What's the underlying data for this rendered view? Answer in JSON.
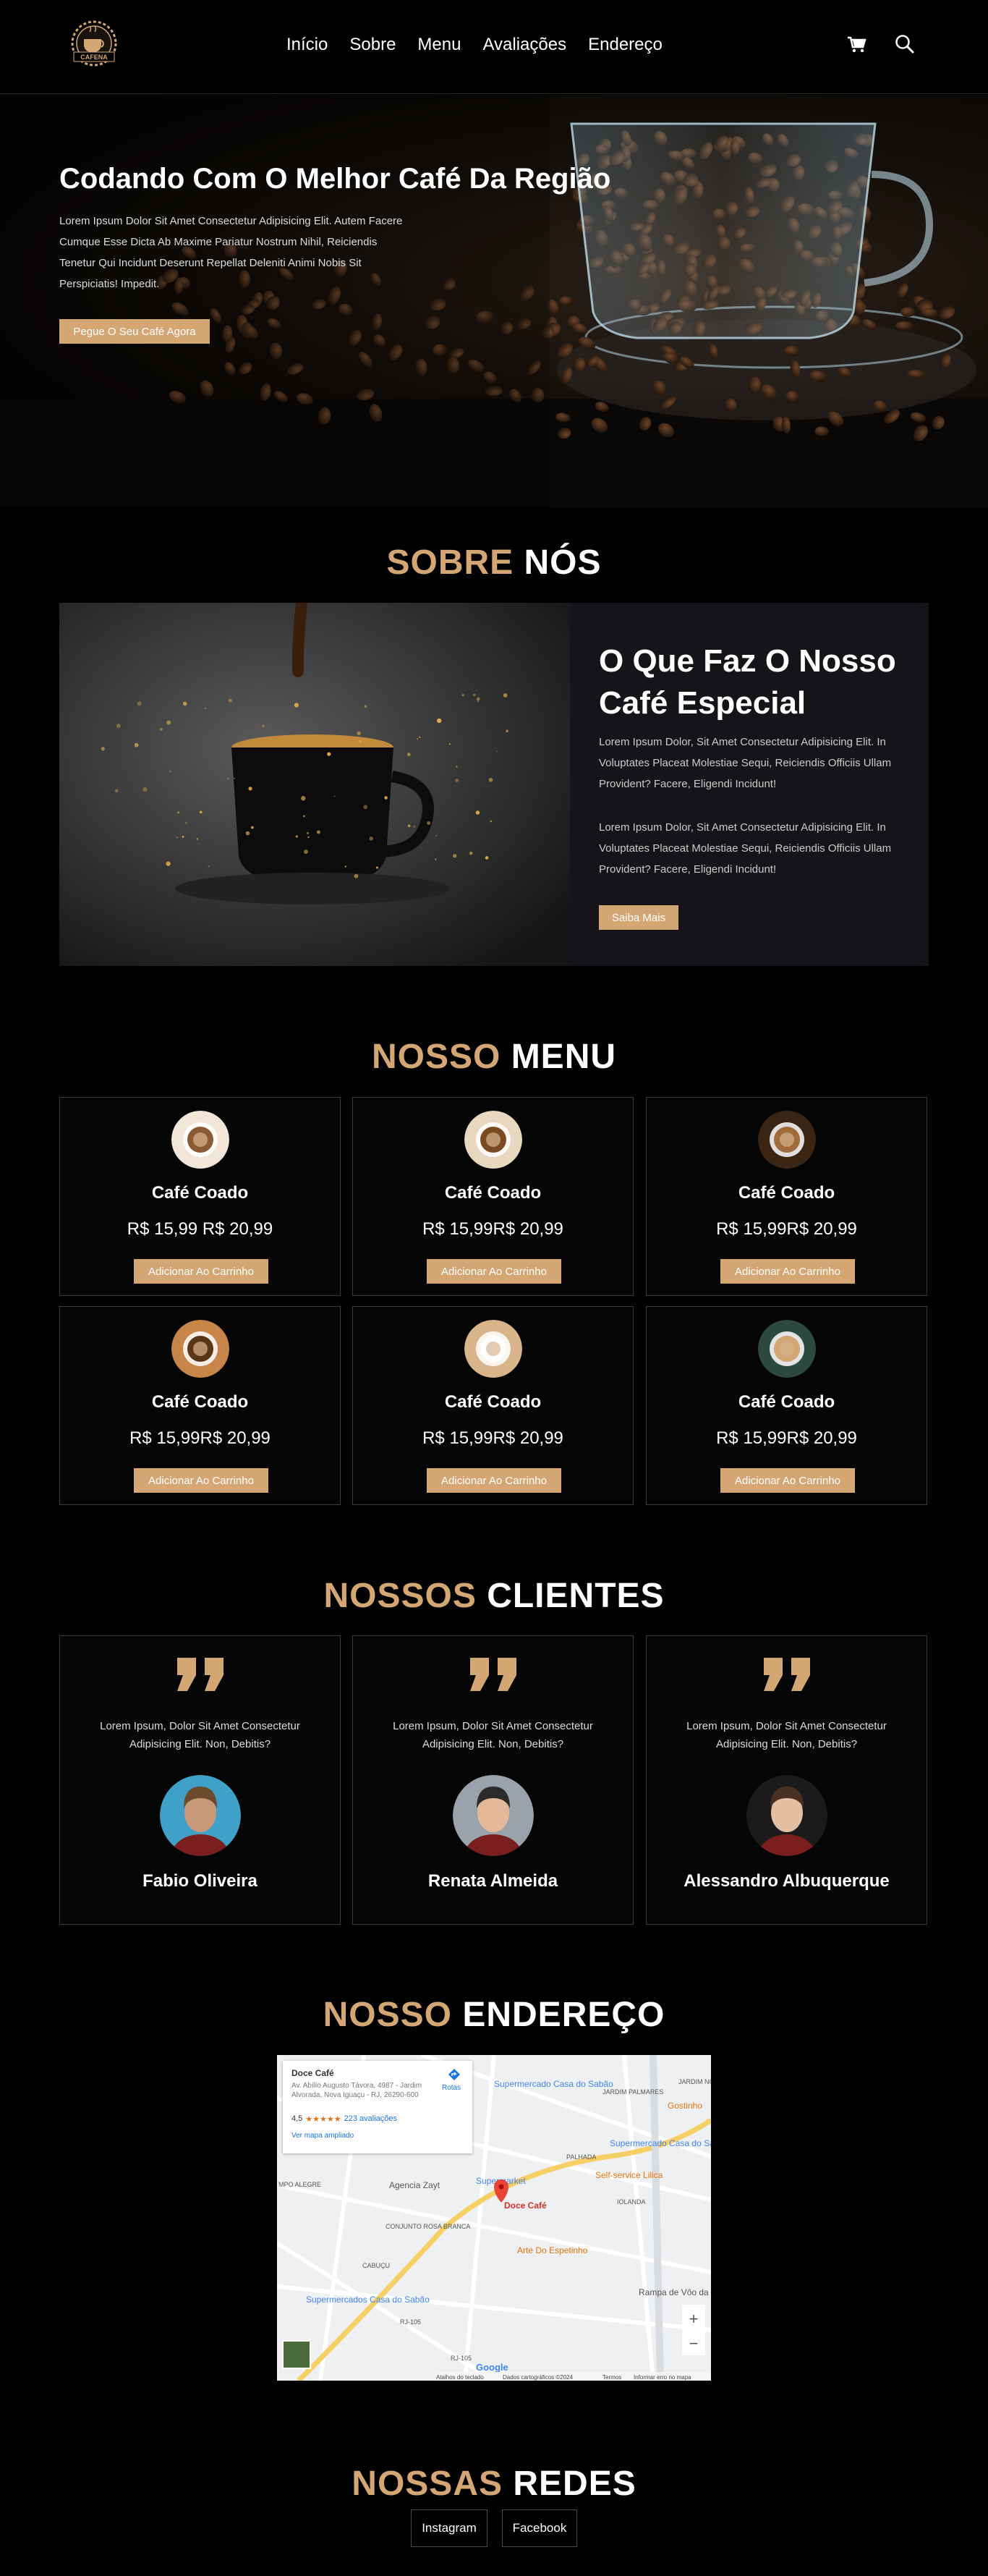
{
  "header": {
    "logo_text": "CAFENA",
    "nav": [
      "Início",
      "Sobre",
      "Menu",
      "Avaliações",
      "Endereço"
    ],
    "cart_icon": "cart-icon",
    "search_icon": "search-icon"
  },
  "hero": {
    "title": "Codando Com O Melhor Café Da Região",
    "text": "Lorem Ipsum Dolor Sit Amet Consectetur Adipisicing Elit. Autem Facere Cumque Esse Dicta Ab Maxime Pariatur Nostrum Nihil, Reiciendis Tenetur Qui Incidunt Deserunt Repellat Deleniti Animi Nobis Sit Perspiciatis! Impedit.",
    "button": "Pegue O Seu Café Agora"
  },
  "about": {
    "title_accent": "SOBRE",
    "title_rest": "NÓS",
    "heading": "O Que Faz O Nosso Café Especial",
    "p1": "Lorem Ipsum Dolor, Sit Amet Consectetur Adipisicing Elit. In Voluptates Placeat Molestiae Sequi, Reiciendis Officiis Ullam Provident? Facere, Eligendi Incidunt!",
    "p2": "Lorem Ipsum Dolor, Sit Amet Consectetur Adipisicing Elit. In Voluptates Placeat Molestiae Sequi, Reiciendis Officiis Ullam Provident? Facere, Eligendi Incidunt!",
    "button": "Saiba Mais"
  },
  "menu": {
    "title_accent": "NOSSO",
    "title_rest": "MENU",
    "items": [
      {
        "name": "Café Coado",
        "price": "R$ 15,99 R$ 20,99",
        "button": "Adicionar Ao Carrinho"
      },
      {
        "name": "Café Coado",
        "price": "R$ 15,99R$ 20,99",
        "button": "Adicionar Ao Carrinho"
      },
      {
        "name": "Café Coado",
        "price": "R$ 15,99R$ 20,99",
        "button": "Adicionar Ao Carrinho"
      },
      {
        "name": "Café Coado",
        "price": "R$ 15,99R$ 20,99",
        "button": "Adicionar Ao Carrinho"
      },
      {
        "name": "Café Coado",
        "price": "R$ 15,99R$ 20,99",
        "button": "Adicionar Ao Carrinho"
      },
      {
        "name": "Café Coado",
        "price": "R$ 15,99R$ 20,99",
        "button": "Adicionar Ao Carrinho"
      }
    ]
  },
  "clients": {
    "title_accent": "NOSSOS",
    "title_rest": "CLIENTES",
    "items": [
      {
        "text": "Lorem Ipsum, Dolor Sit Amet Consectetur Adipisicing Elit. Non, Debitis?",
        "name": "Fabio Oliveira"
      },
      {
        "text": "Lorem Ipsum, Dolor Sit Amet Consectetur Adipisicing Elit. Non, Debitis?",
        "name": "Renata Almeida"
      },
      {
        "text": "Lorem Ipsum, Dolor Sit Amet Consectetur Adipisicing Elit. Non, Debitis?",
        "name": "Alessandro Albuquerque"
      }
    ]
  },
  "address": {
    "title_accent": "NOSSO",
    "title_rest": "ENDEREÇO",
    "map": {
      "place_name": "Doce Café",
      "place_address": "Av. Abílio Augusto Távora, 4987 - Jardim Alvorada, Nova Iguaçu - RJ, 26290-600",
      "rating": "4,5",
      "stars": "★★★★★",
      "reviews": "223 avaliações",
      "larger_map": "Ver mapa ampliado",
      "routes": "Rotas",
      "labels": {
        "supermercado1": "Supermercado Casa do Sabão",
        "jardim_palmares": "JARDIM PALMARES",
        "jardim_nova": "JARDIM NOVA B",
        "gostinho": "Gostinho",
        "supermercado2": "Supermercado Casa do Sabão",
        "palhada": "PALHADA",
        "agencia": "Agencia Zayt",
        "supermarket": "Supermarket",
        "self_service": "Self-service Lilica",
        "iolanda": "IOLANDA",
        "mpo_alegre": "MPO ALEGRE",
        "conjunto": "CONJUNTO ROSA BRANCA",
        "doce_cafe_pin": "Doce Café",
        "espetinho": "Arte Do Espetinho",
        "cabucu": "CABUÇU",
        "supermercado3": "Supermercados Casa do Sabão",
        "rampa": "Rampa de Vôo da Serra do Vi",
        "rj105": "RJ-105",
        "rj105b": "RJ-105"
      },
      "google": "Google",
      "footer": [
        "Atalhos do teclado",
        "Dados cartográficos ©2024",
        "Termos",
        "Informar erro no mapa"
      ],
      "zoom_in": "+",
      "zoom_out": "−"
    }
  },
  "social": {
    "title_accent": "NOSSAS",
    "title_rest": "REDES",
    "links": [
      "Instagram",
      "Facebook"
    ]
  },
  "colors": {
    "accent": "#d3a674",
    "background": "#000000",
    "panel": "#141419"
  }
}
